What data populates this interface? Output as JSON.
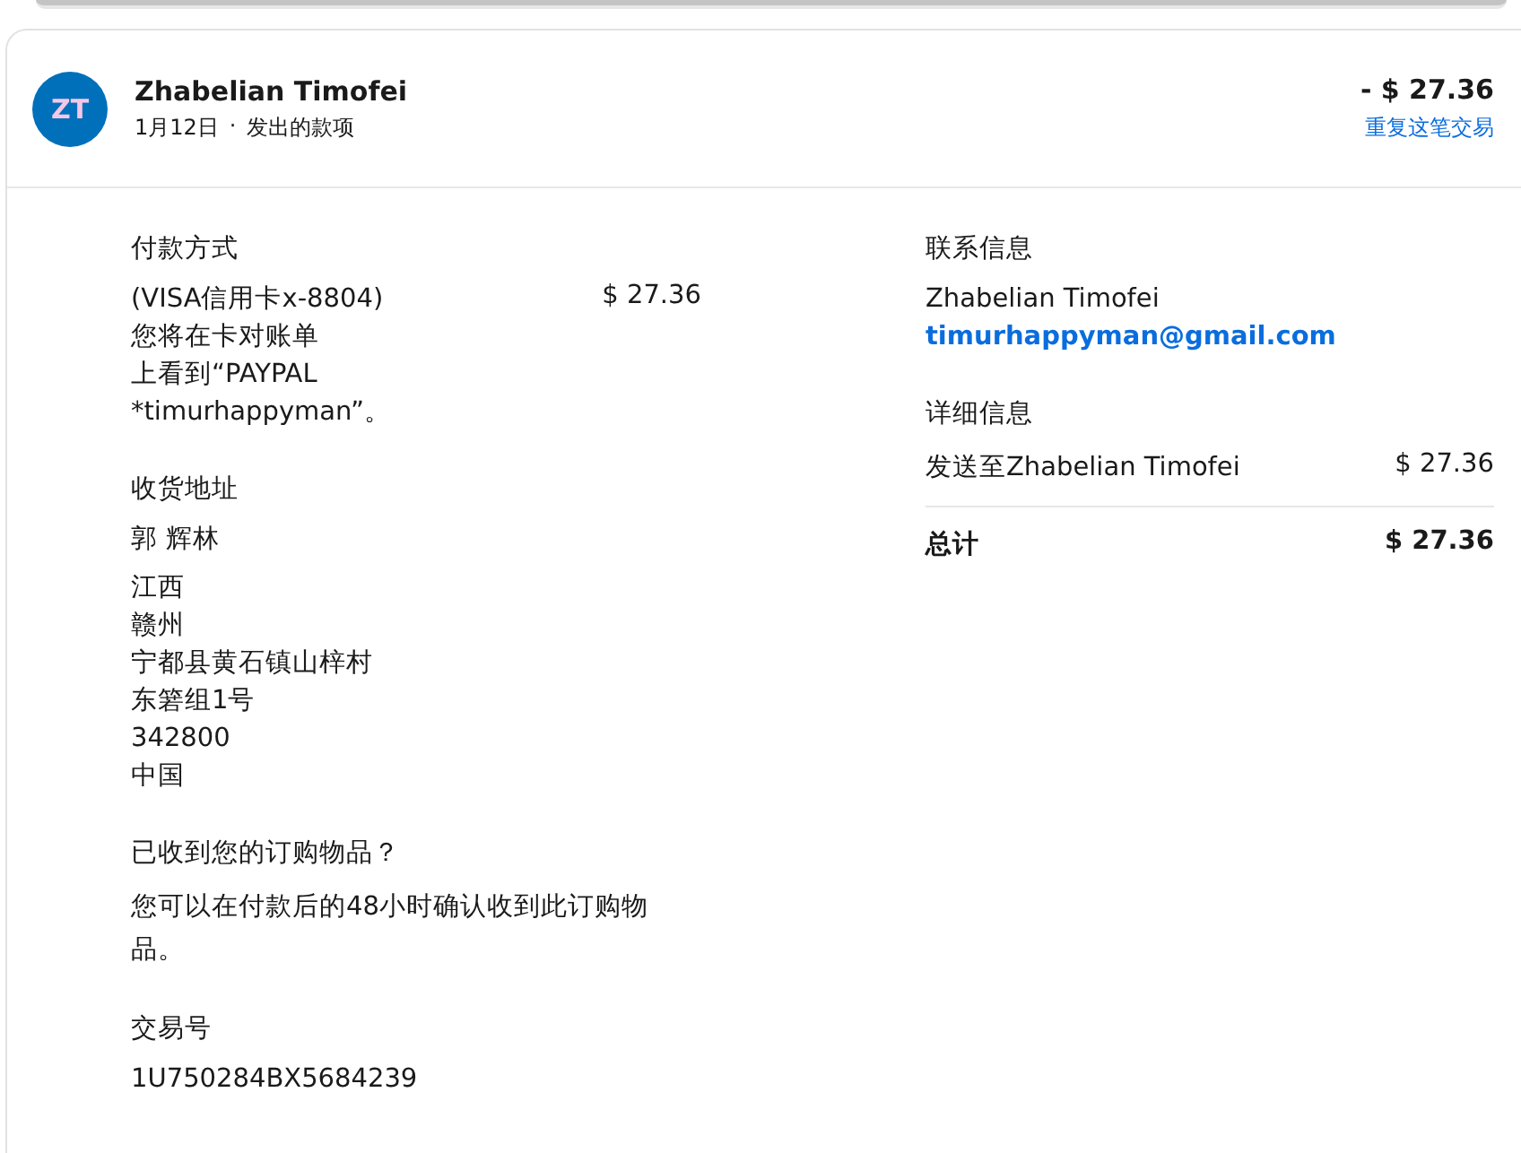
{
  "header": {
    "avatar": "ZT",
    "name": "Zhabelian Timofei",
    "date": "1月12日",
    "separator": "·",
    "type": "发出的款项",
    "amount": "- $ 27.36",
    "repeat_link": "重复这笔交易"
  },
  "payment": {
    "heading": "付款方式",
    "method": "(VISA信用卡x-8804)",
    "amount": "$ 27.36",
    "note_lines": [
      "您将在卡对账单",
      "上看到“PAYPAL",
      "*timurhappyman”。"
    ]
  },
  "shipping": {
    "heading": "收货地址",
    "name": "郭 辉林",
    "lines": [
      "江西",
      "赣州",
      "宁都县黄石镇山梓村",
      "东箬组1号",
      "342800",
      "中国"
    ]
  },
  "received": {
    "heading": "已收到您的订购物品？",
    "text": "您可以在付款后的48小时确认收到此订购物品。"
  },
  "transaction": {
    "heading": "交易号",
    "id": "1U750284BX5684239"
  },
  "contact": {
    "heading": "联系信息",
    "name": "Zhabelian Timofei",
    "email": "timurhappyman@gmail.com"
  },
  "details": {
    "heading": "详细信息",
    "rows": [
      {
        "label": "发送至Zhabelian Timofei",
        "amount": "$ 27.36"
      }
    ],
    "total_label": "总计",
    "total_amount": "$ 27.36"
  }
}
